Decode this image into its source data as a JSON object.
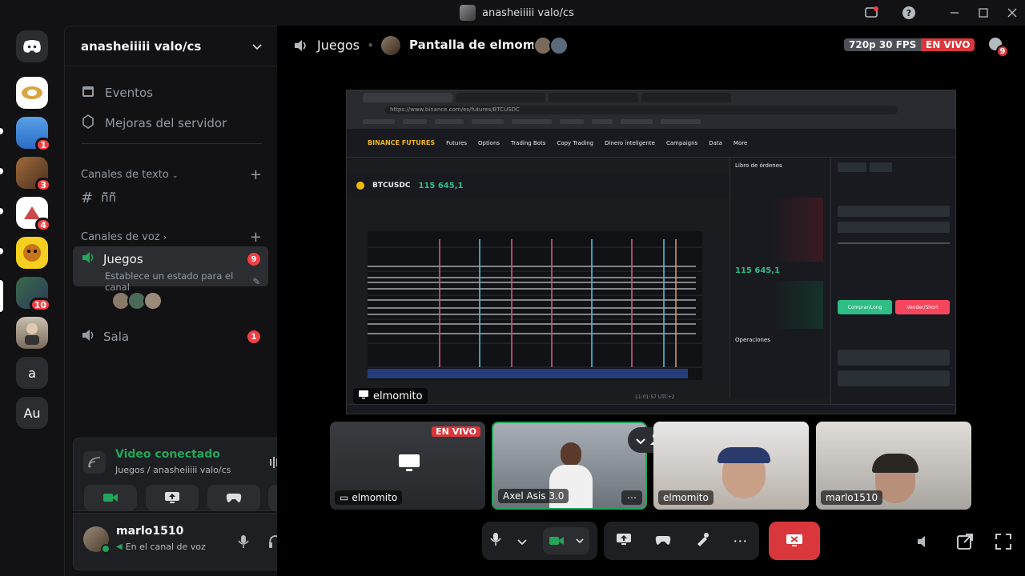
{
  "titlebar": {
    "app_title": "anasheiiiii valo/cs",
    "icons": [
      "inbox-icon",
      "help-icon",
      "minimize-icon",
      "maximize-icon",
      "close-icon"
    ]
  },
  "rail": {
    "servers": [
      {
        "name": "discord-home",
        "label": "",
        "badge": ""
      },
      {
        "name": "server-1",
        "label": "",
        "badge": ""
      },
      {
        "name": "server-2",
        "label": "",
        "badge": "1"
      },
      {
        "name": "server-3",
        "label": "",
        "badge": "3"
      },
      {
        "name": "server-4",
        "label": "",
        "badge": "4"
      },
      {
        "name": "server-5",
        "label": "",
        "badge": ""
      },
      {
        "name": "server-6",
        "label": "",
        "badge": "10"
      },
      {
        "name": "server-7",
        "label": "",
        "badge": ""
      },
      {
        "name": "server-a",
        "label": "a",
        "badge": ""
      },
      {
        "name": "server-au",
        "label": "Au",
        "badge": ""
      }
    ]
  },
  "sidebar": {
    "guild_name": "anasheiiiii valo/cs",
    "events_label": "Eventos",
    "boost_label": "Mejoras del servidor",
    "text_category": "Canales de texto",
    "text_channel": "ñ̃ñ̃",
    "voice_category": "Canales de voz",
    "voice_channels": [
      {
        "label": "Juegos",
        "badge": "9",
        "status": "Establece un estado para el canal"
      },
      {
        "label": "Sala",
        "badge": "1"
      }
    ]
  },
  "voice_panel": {
    "status": "Video conectado",
    "location": "Juegos / anasheiiiii valo/cs"
  },
  "user_panel": {
    "username": "marlo1510",
    "status": "En el canal de voz"
  },
  "main_header": {
    "channel": "Juegos",
    "stream_title": "Pantalla de elmomito",
    "quality": "720p 30 FPS",
    "live": "EN VIVO",
    "viewers_badge": "9"
  },
  "stream": {
    "owner": "elmomito",
    "url": "https://www.binance.com/es/futures/BTCUSDC",
    "symbol": "BTCUSDC",
    "price": "115 645,1",
    "orderbook_title": "Libro de órdenes",
    "orderbook_price": "115 645,1",
    "trades_title": "Operaciones",
    "buy_label": "Comprar/Long",
    "sell_label": "Vender/Short",
    "nav": [
      "Futures",
      "Options",
      "Trading Bots",
      "Copy Trading",
      "Dinero inteligente",
      "Campaigns",
      "Data",
      "More"
    ],
    "brand": "BINANCE FUTURES",
    "clock": "11:01:57 UTC+2"
  },
  "tiles": [
    {
      "label": "elmomito",
      "live": "EN VIVO"
    },
    {
      "label": "Axel Asis 3.0"
    },
    {
      "label": "elmomito"
    },
    {
      "label": "marlo1510"
    }
  ],
  "colors": {
    "green": "#23a55a",
    "red": "#f23f43",
    "live_red": "#da373c"
  }
}
